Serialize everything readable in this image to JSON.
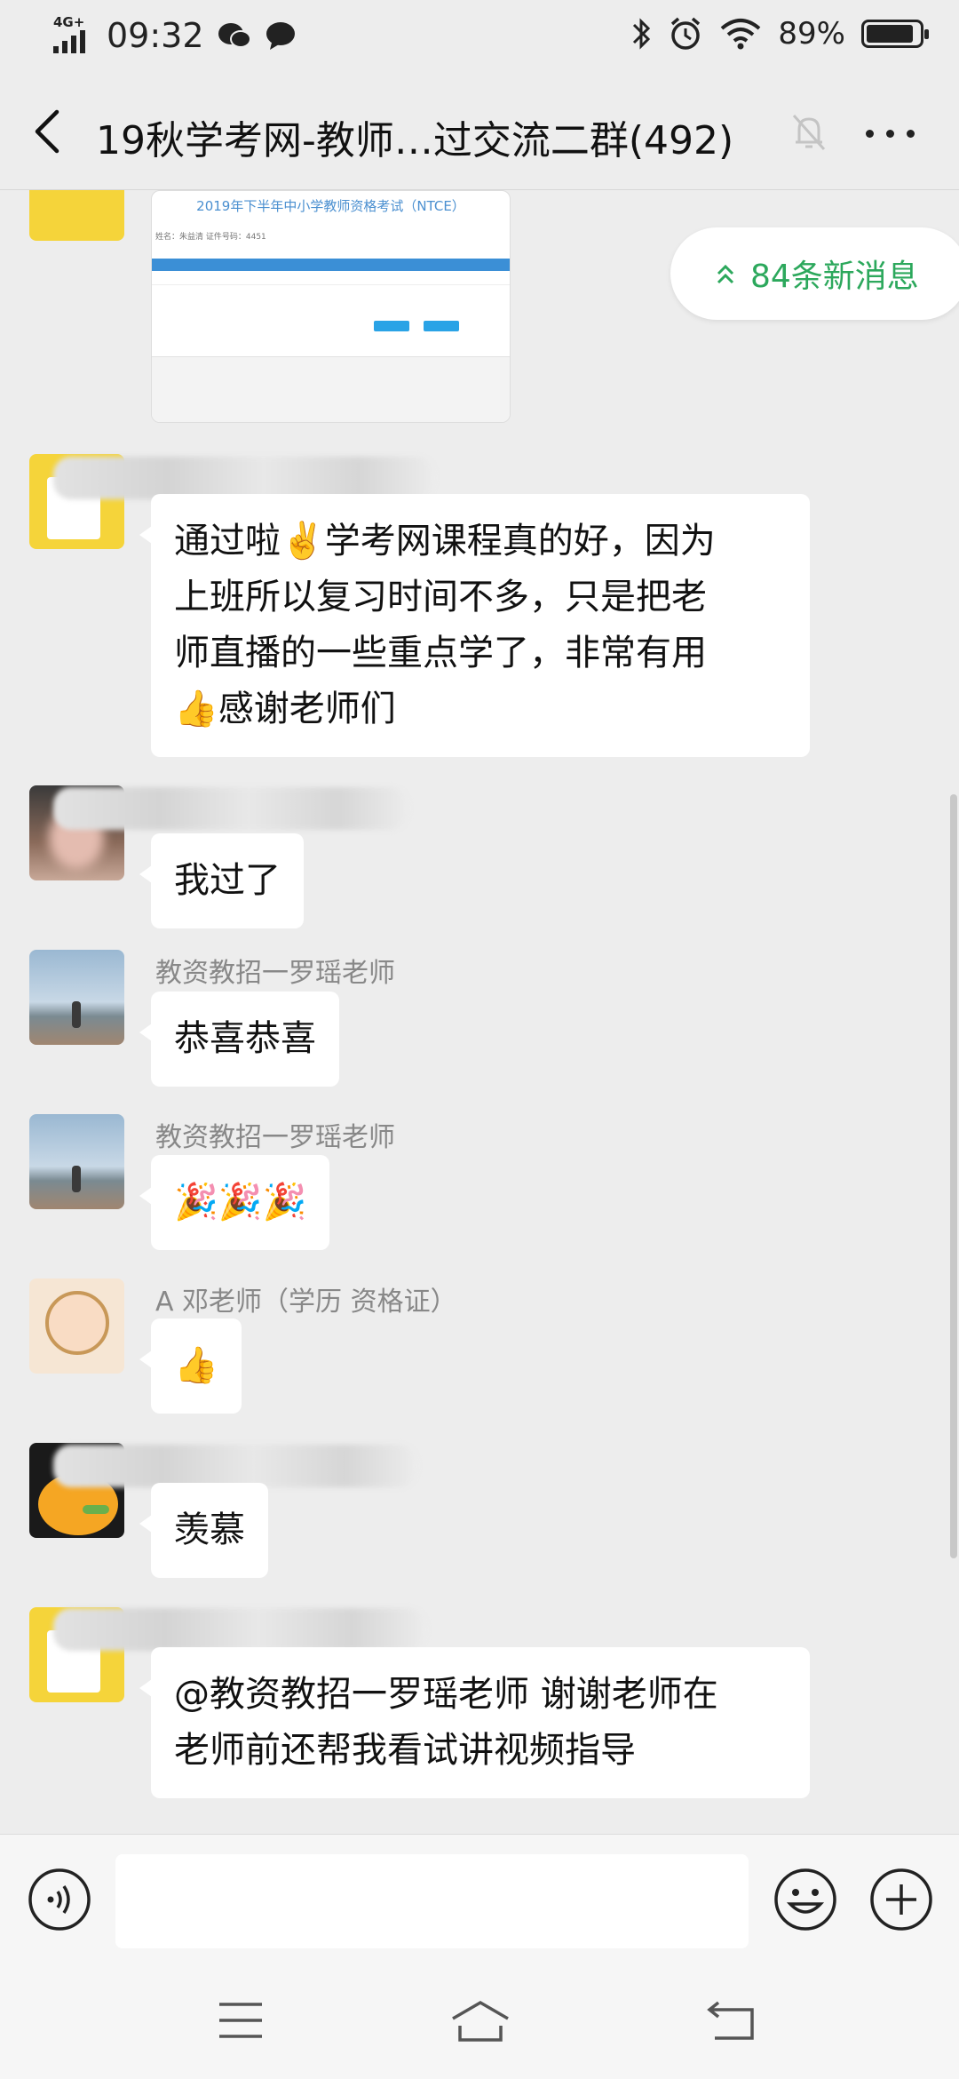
{
  "status_bar": {
    "network": "4G+",
    "time": "09:32",
    "battery": "89%",
    "battery_level": 0.89
  },
  "header": {
    "title": "19秋学考网-教师…过交流二群(492)",
    "back_icon": "chevron-left-icon",
    "mute_icon": "bell-off-icon",
    "more_icon": "more-dots-icon"
  },
  "chat": {
    "new_messages": "84条新消息",
    "shared_image": {
      "caption": "2019年下半年中小学教师资格考试（NTCE）",
      "meta": "姓名：朱益清  证件号码：4451"
    },
    "messages": [
      {
        "sender": "",
        "text_lines": [
          "通过啦✌️学考网课程真的好，因为",
          "上班所以复习时间不多，只是把老",
          "师直播的一些重点学了，非常有用",
          "👍感谢老师们"
        ]
      },
      {
        "sender": "",
        "text_lines": [
          "我过了"
        ]
      },
      {
        "sender": "教资教招一罗瑶老师",
        "text_lines": [
          "恭喜恭喜"
        ]
      },
      {
        "sender": "教资教招一罗瑶老师",
        "text_lines": [
          "🎉🎉🎉"
        ]
      },
      {
        "sender": "A 邓老师（学历 资格证）",
        "text_lines": [
          "👍"
        ]
      },
      {
        "sender": "",
        "text_lines": [
          "羡慕"
        ]
      },
      {
        "sender": "",
        "text_lines": [
          "@教资教招一罗瑶老师  谢谢老师在",
          "老师前还帮我看试讲视频指导"
        ]
      }
    ]
  },
  "input_bar": {
    "voice_icon": "voice-icon",
    "emoji_icon": "emoji-icon",
    "plus_icon": "plus-icon"
  },
  "nav_bar": {
    "menu_icon": "menu-icon",
    "home_icon": "home-icon",
    "back_icon": "back-icon"
  },
  "colors": {
    "background": "#ededed",
    "bubble": "#ffffff",
    "accent_green": "#2ca85c",
    "sender_gray": "#888888"
  }
}
